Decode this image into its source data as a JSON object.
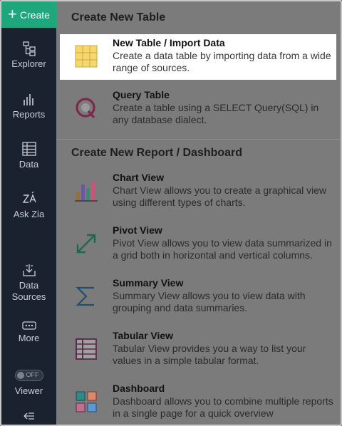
{
  "sidebar": {
    "create_label": "Create",
    "items": [
      {
        "label": "Explorer",
        "icon": "explorer-icon"
      },
      {
        "label": "Reports",
        "icon": "reports-icon"
      },
      {
        "label": "Data",
        "icon": "data-icon"
      },
      {
        "label": "Ask Zia",
        "icon": "ask-zia-icon"
      },
      {
        "label": "Data\nSources",
        "icon": "data-sources-icon"
      },
      {
        "label": "More",
        "icon": "more-icon"
      },
      {
        "label": "Viewer",
        "icon": "viewer-toggle",
        "toggle_text": "OFF"
      }
    ]
  },
  "main": {
    "table_section_title": "Create New Table",
    "report_section_title": "Create New Report / Dashboard",
    "table_items": [
      {
        "title": "New Table / Import Data",
        "desc": "Create a data table by importing data from a wide range of sources.",
        "icon": "grid-table-icon"
      },
      {
        "title": "Query Table",
        "desc": "Create a table using a SELECT Query(SQL) in any database dialect.",
        "icon": "query-icon"
      }
    ],
    "report_items": [
      {
        "title": "Chart View",
        "desc": "Chart View allows you to create a graphical view using different types of charts.",
        "icon": "bar-chart-icon"
      },
      {
        "title": "Pivot View",
        "desc": "Pivot View allows you to view data summarized in a grid both in horizontal and vertical columns.",
        "icon": "pivot-arrows-icon"
      },
      {
        "title": "Summary View",
        "desc": "Summary View allows you to view data with grouping and data summaries.",
        "icon": "sigma-icon"
      },
      {
        "title": "Tabular View",
        "desc": "Tabular View provides you a way to list your values in a simple tabular format.",
        "icon": "tabular-icon"
      },
      {
        "title": "Dashboard",
        "desc": "Dashboard allows you to combine multiple reports in a single page for a quick overview",
        "icon": "dashboard-icon"
      }
    ]
  },
  "colors": {
    "sidebar_bg": "#1b222f",
    "create_green": "#1fa67a",
    "overlay_gray": "#7b7b7b",
    "highlight_bg": "#ffffff"
  }
}
